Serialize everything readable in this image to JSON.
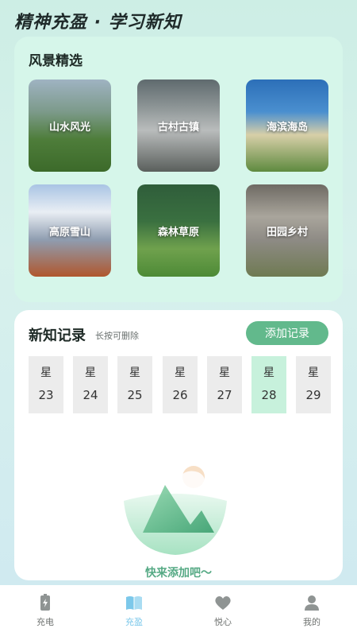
{
  "header": {
    "title": "精神充盈 · 学习新知"
  },
  "scenery": {
    "title": "风景精选",
    "items": [
      {
        "label": "山水风光"
      },
      {
        "label": "古村古镇"
      },
      {
        "label": "海滨海岛"
      },
      {
        "label": "高原雪山"
      },
      {
        "label": "森林草原"
      },
      {
        "label": "田园乡村"
      }
    ]
  },
  "records": {
    "title": "新知记录",
    "hint": "长按可删除",
    "add_label": "添加记录",
    "days": [
      {
        "week": "星",
        "date": "23"
      },
      {
        "week": "星",
        "date": "24"
      },
      {
        "week": "星",
        "date": "25"
      },
      {
        "week": "星",
        "date": "26"
      },
      {
        "week": "星",
        "date": "27"
      },
      {
        "week": "星",
        "date": "28",
        "selected": true
      },
      {
        "week": "星",
        "date": "29"
      }
    ],
    "empty_text": "快来添加吧～"
  },
  "tabbar": {
    "items": [
      {
        "label": "充电",
        "icon": "battery-icon"
      },
      {
        "label": "充盈",
        "icon": "book-icon",
        "active": true
      },
      {
        "label": "悦心",
        "icon": "heart-icon"
      },
      {
        "label": "我的",
        "icon": "person-icon"
      }
    ],
    "active_color": "#7cc8ea",
    "inactive_color": "#6f7371"
  },
  "colors": {
    "accent": "#62b98c",
    "selected_day": "#c7f1dc"
  }
}
